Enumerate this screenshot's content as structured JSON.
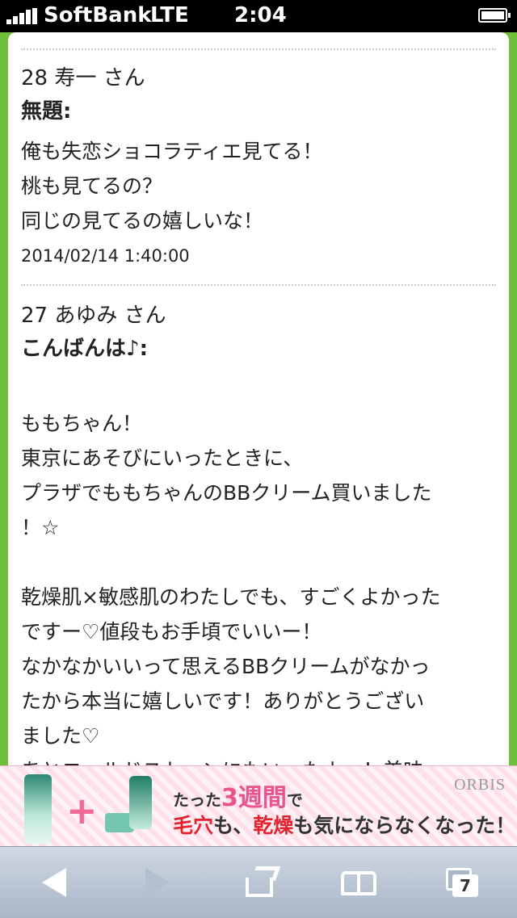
{
  "status_bar": {
    "carrier": "SoftBank",
    "network": "LTE",
    "time": "2:04"
  },
  "posts": [
    {
      "header": "28 寿一 さん",
      "title": "無題:",
      "body": "俺も失恋ショコラティエ見てる！\n桃も見てるの？\n同じの見てるの嬉しいな！",
      "date": "2014/02/14 1:40:00"
    },
    {
      "header": "27 あゆみ さん",
      "title": "こんばんは♪:",
      "body": "\nももちゃん！\n東京にあそびにいったときに、\nプラザでももちゃんのBBクリーム買いました\n！☆\n\n乾燥肌×敏感肌のわたしでも、すごくよかった\nですー♡値段もお手頃でいいー！\nなかなかいいって思えるBBクリームがなかっ\nたから本当に嬉しいです！ありがとうござい\nました♡\nあとコールドストーンにもいったよー！美味"
    }
  ],
  "ad": {
    "brand": "ORBIS",
    "line1_prefix": "たった",
    "line1_emphasis": "3週間",
    "line1_suffix": "で",
    "line2_a": "毛穴",
    "line2_b": "も、",
    "line2_c": "乾燥",
    "line2_d": "も気にならなくなった！"
  },
  "toolbar": {
    "tab_count": "7"
  },
  "colors": {
    "frame_green": "#6fbf3a",
    "toolbar": "#a9b6c7"
  }
}
